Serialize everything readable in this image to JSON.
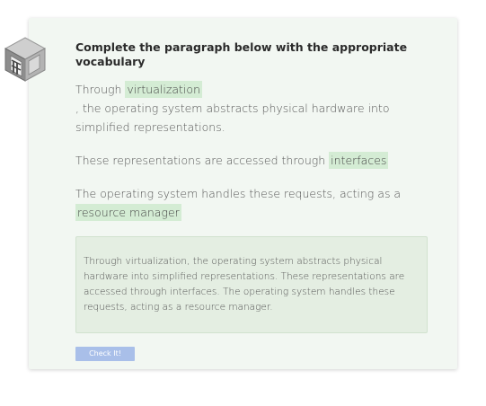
{
  "exercise": {
    "icon": "server-rack-icon",
    "title": "Complete the paragraph below with the appropriate vocabulary",
    "paragraphs": [
      {
        "before": "Through ",
        "blank": "virtualization",
        "after": ", the operating system abstracts physical hardware into simplified representations."
      },
      {
        "before": "These representations are accessed through ",
        "blank": "interfaces",
        "after": ""
      },
      {
        "before": "The operating system handles these requests, acting as a ",
        "blank": "resource manager",
        "after": ""
      }
    ],
    "answer_text": "Through virtualization, the operating system abstracts physical hardware into simplified representations. These representations are accessed through interfaces. The operating system handles these requests, acting as a resource manager.",
    "check_label": "Check It!"
  },
  "colors": {
    "card_bg": "#f2f7f2",
    "chip_bg": "#d4ecd4",
    "answer_bg": "#e4eee2",
    "button_bg": "#a9bfe9"
  }
}
